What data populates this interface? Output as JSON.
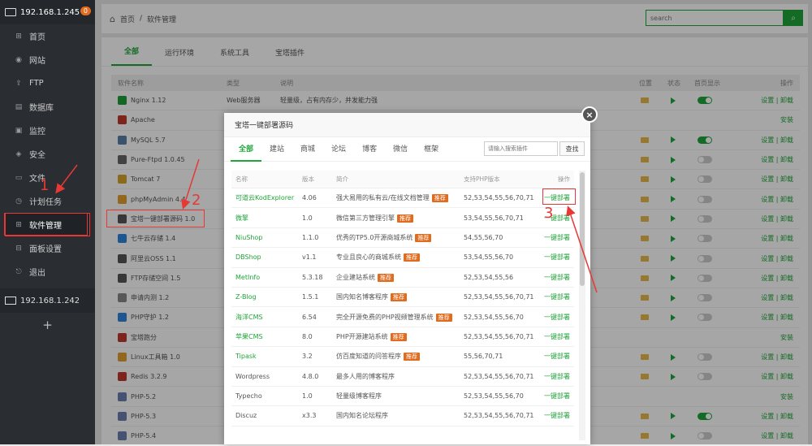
{
  "sidebar": {
    "server1": "192.168.1.245",
    "badge": "0",
    "items": [
      {
        "label": "首页",
        "icon": "home-icon"
      },
      {
        "label": "网站",
        "icon": "globe-icon"
      },
      {
        "label": "FTP",
        "icon": "ftp-icon"
      },
      {
        "label": "数据库",
        "icon": "database-icon"
      },
      {
        "label": "监控",
        "icon": "monitor-icon"
      },
      {
        "label": "安全",
        "icon": "shield-icon"
      },
      {
        "label": "文件",
        "icon": "folder-icon"
      },
      {
        "label": "计划任务",
        "icon": "clock-icon"
      },
      {
        "label": "软件管理",
        "icon": "grid-icon"
      },
      {
        "label": "面板设置",
        "icon": "settings-icon"
      },
      {
        "label": "退出",
        "icon": "logout-icon"
      }
    ],
    "server2": "192.168.1.242",
    "add": "+"
  },
  "topbar": {
    "home": "首页",
    "sep": "/",
    "current": "软件管理",
    "search_placeholder": "search"
  },
  "main": {
    "tabs": [
      "全部",
      "运行环境",
      "系统工具",
      "宝塔插件"
    ],
    "headers": {
      "name": "软件名称",
      "type": "类型",
      "desc": "说明",
      "loc": "位置",
      "status": "状态",
      "home": "首页显示",
      "ops": "操作"
    },
    "rows": [
      {
        "name": "Nginx 1.12",
        "type": "Web服务器",
        "desc": "轻量级，占有内存少，并发能力强",
        "color": "#1e9e3a",
        "folder": true,
        "play": true,
        "toggle": "on",
        "ops": "设置 | 卸载"
      },
      {
        "name": "Apache",
        "type": "",
        "desc": "",
        "color": "#c0392b",
        "folder": false,
        "play": false,
        "toggle": "",
        "ops": "安装"
      },
      {
        "name": "MySQL 5.7",
        "type": "",
        "desc": "",
        "color": "#5a7ea6",
        "folder": true,
        "play": true,
        "toggle": "on",
        "ops": "设置 | 卸载"
      },
      {
        "name": "Pure-Ftpd 1.0.45",
        "type": "",
        "desc": "",
        "color": "#666",
        "folder": true,
        "play": true,
        "toggle": "off",
        "ops": "设置 | 卸载"
      },
      {
        "name": "Tomcat 7",
        "type": "",
        "desc": "",
        "color": "#d6a42b",
        "folder": true,
        "play": true,
        "toggle": "off",
        "ops": "设置 | 卸载"
      },
      {
        "name": "phpMyAdmin 4.4",
        "type": "",
        "desc": "",
        "color": "#e0a030",
        "folder": true,
        "play": true,
        "toggle": "off",
        "ops": "设置 | 卸载"
      },
      {
        "name": "宝塔一键部署源码 1.0",
        "type": "",
        "desc": "",
        "color": "#555",
        "folder": true,
        "play": true,
        "toggle": "off",
        "ops": "设置 | 卸载"
      },
      {
        "name": "七牛云存储 1.4",
        "type": "",
        "desc": "",
        "color": "#2e86de",
        "folder": true,
        "play": true,
        "toggle": "off",
        "ops": "设置 | 卸载"
      },
      {
        "name": "阿里云OSS 1.1",
        "type": "",
        "desc": "",
        "color": "#555",
        "folder": true,
        "play": true,
        "toggle": "off",
        "ops": "设置 | 卸载"
      },
      {
        "name": "FTP存储空间 1.5",
        "type": "",
        "desc": "",
        "color": "#555",
        "folder": true,
        "play": true,
        "toggle": "off",
        "ops": "设置 | 卸载"
      },
      {
        "name": "申请内测 1.2",
        "type": "",
        "desc": "",
        "color": "#888",
        "folder": true,
        "play": true,
        "toggle": "off",
        "ops": "设置 | 卸载"
      },
      {
        "name": "PHP守护 1.2",
        "type": "",
        "desc": "",
        "color": "#2e86de",
        "folder": true,
        "play": true,
        "toggle": "off",
        "ops": "设置 | 卸载"
      },
      {
        "name": "宝塔跑分",
        "type": "",
        "desc": "",
        "color": "#c0392b",
        "folder": false,
        "play": false,
        "toggle": "",
        "ops": "安装"
      },
      {
        "name": "Linux工具箱 1.0",
        "type": "",
        "desc": "",
        "color": "#e0a030",
        "folder": true,
        "play": true,
        "toggle": "off",
        "ops": "设置 | 卸载"
      },
      {
        "name": "Redis 3.2.9",
        "type": "",
        "desc": "",
        "color": "#c0392b",
        "folder": true,
        "play": true,
        "toggle": "off",
        "ops": "设置 | 卸载"
      },
      {
        "name": "PHP-5.2",
        "type": "",
        "desc": "",
        "color": "#6c7fb0",
        "folder": false,
        "play": false,
        "toggle": "",
        "ops": "安装"
      },
      {
        "name": "PHP-5.3",
        "type": "",
        "desc": "",
        "color": "#6c7fb0",
        "folder": true,
        "play": true,
        "toggle": "on",
        "ops": "设置 | 卸载"
      },
      {
        "name": "PHP-5.4",
        "type": "语言解释器",
        "desc": "PHP是世界上最好的编程语言",
        "color": "#6c7fb0",
        "folder": true,
        "play": true,
        "toggle": "off",
        "ops": "设置 | 卸载"
      }
    ]
  },
  "modal": {
    "title": "宝塔一键部署源码",
    "tabs": [
      "全部",
      "建站",
      "商城",
      "论坛",
      "博客",
      "微信",
      "框架"
    ],
    "search_placeholder": "请输入搜索插件",
    "search_btn": "查找",
    "headers": {
      "name": "名称",
      "ver": "版本",
      "desc": "简介",
      "php": "支持PHP版本",
      "op": "操作"
    },
    "rows": [
      {
        "name": "可道云KodExplorer",
        "ver": "4.06",
        "desc": "强大易用的私有云/在线文档管理",
        "rec": true,
        "php": "52,53,54,55,56,70,71",
        "op": "一键部署",
        "green": true
      },
      {
        "name": "微擎",
        "ver": "1.0",
        "desc": "微信第三方管理引擎",
        "rec": true,
        "php": "53,54,55,56,70,71",
        "op": "一键部署",
        "green": true
      },
      {
        "name": "NiuShop",
        "ver": "1.1.0",
        "desc": "优秀的TP5.0开源商城系统",
        "rec": true,
        "php": "54,55,56,70",
        "op": "一键部署",
        "green": true
      },
      {
        "name": "DBShop",
        "ver": "v1.1",
        "desc": "专业且良心的商城系统",
        "rec": true,
        "php": "53,54,55,56,70",
        "op": "一键部署",
        "green": true
      },
      {
        "name": "MetInfo",
        "ver": "5.3.18",
        "desc": "企业建站系统",
        "rec": true,
        "php": "52,53,54,55,56",
        "op": "一键部署",
        "green": true
      },
      {
        "name": "Z-Blog",
        "ver": "1.5.1",
        "desc": "国内知名博客程序",
        "rec": true,
        "php": "52,53,54,55,56,70,71",
        "op": "一键部署",
        "green": true
      },
      {
        "name": "海洋CMS",
        "ver": "6.54",
        "desc": "完全开源免费的PHP视频管理系统",
        "rec": true,
        "php": "52,53,54,55,56,70",
        "op": "一键部署",
        "green": true
      },
      {
        "name": "苹果CMS",
        "ver": "8.0",
        "desc": "PHP开源建站系统",
        "rec": true,
        "php": "52,53,54,55,56,70,71",
        "op": "一键部署",
        "green": true
      },
      {
        "name": "Tipask",
        "ver": "3.2",
        "desc": "仿百度知道的问答程序",
        "rec": true,
        "php": "55,56,70,71",
        "op": "一键部署",
        "green": true
      },
      {
        "name": "Wordpress",
        "ver": "4.8.0",
        "desc": "最多人用的博客程序",
        "rec": false,
        "php": "52,53,54,55,56,70,71",
        "op": "一键部署",
        "green": false
      },
      {
        "name": "Typecho",
        "ver": "1.0",
        "desc": "轻量级博客程序",
        "rec": false,
        "php": "52,53,54,55,56,70",
        "op": "一键部署",
        "green": false
      },
      {
        "name": "Discuz",
        "ver": "x3.3",
        "desc": "国内知名论坛程序",
        "rec": false,
        "php": "52,53,54,55,56,70,71",
        "op": "一键部署",
        "green": false
      }
    ],
    "rec_label": "推荐"
  },
  "annotations": {
    "n1": "1",
    "n2": "2",
    "n3": "3"
  },
  "accent": "#20a53a"
}
